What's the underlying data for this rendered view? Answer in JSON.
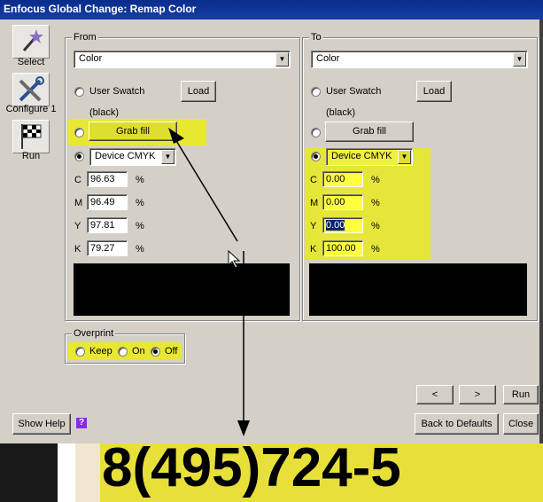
{
  "window": {
    "title": "Enfocus Global Change: Remap Color"
  },
  "toolbar": {
    "select_label": "Select",
    "configure_label": "Configure 1",
    "run_label": "Run"
  },
  "from": {
    "group_label": "From",
    "mode_value": "Color",
    "user_swatch_label": "User Swatch",
    "load_label": "Load",
    "swatch_name": "(black)",
    "grab_fill_label": "Grab fill",
    "color_space_value": "Device CMYK",
    "channels": [
      {
        "letter": "C",
        "value": "96.63",
        "unit": "%"
      },
      {
        "letter": "M",
        "value": "96.49",
        "unit": "%"
      },
      {
        "letter": "Y",
        "value": "97.81",
        "unit": "%"
      },
      {
        "letter": "K",
        "value": "79.27",
        "unit": "%"
      }
    ]
  },
  "to": {
    "group_label": "To",
    "mode_value": "Color",
    "user_swatch_label": "User Swatch",
    "load_label": "Load",
    "swatch_name": "(black)",
    "grab_fill_label": "Grab fill",
    "color_space_value": "Device CMYK",
    "channels": [
      {
        "letter": "C",
        "value": "0.00",
        "unit": "%"
      },
      {
        "letter": "M",
        "value": "0.00",
        "unit": "%"
      },
      {
        "letter": "Y",
        "value": "0.00",
        "unit": "%"
      },
      {
        "letter": "K",
        "value": "100.00",
        "unit": "%"
      }
    ]
  },
  "overprint": {
    "group_label": "Overprint",
    "keep_label": "Keep",
    "on_label": "On",
    "off_label": "Off"
  },
  "nav": {
    "prev_label": "<",
    "next_label": ">",
    "run_label": "Run"
  },
  "footer": {
    "show_help_label": "Show Help",
    "help_icon_label": "?",
    "back_defaults_label": "Back to Defaults",
    "close_label": "Close"
  },
  "background_doc": {
    "phone_text": "8(495)724-5"
  },
  "colors": {
    "highlight": "#e8e832",
    "titlebar": "#0a2d8a",
    "dialog": "#d4d0c8"
  }
}
